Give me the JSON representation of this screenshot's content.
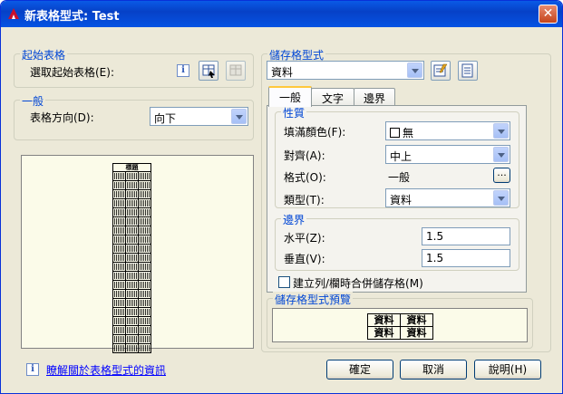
{
  "window": {
    "title": "新表格型式: Test"
  },
  "start_table": {
    "group_label": "起始表格",
    "select_label": "選取起始表格(E):"
  },
  "general": {
    "group_label": "一般",
    "direction_label": "表格方向(D):",
    "direction_value": "向下"
  },
  "left_preview": {
    "header": "標題"
  },
  "cell_style": {
    "group_label": "儲存格型式",
    "selected": "資料"
  },
  "tabs": [
    {
      "label": "一般"
    },
    {
      "label": "文字"
    },
    {
      "label": "邊界"
    }
  ],
  "properties": {
    "group_label": "性質",
    "fill_label": "填滿顏色(F):",
    "fill_value": "無",
    "align_label": "對齊(A):",
    "align_value": "中上",
    "format_label": "格式(O):",
    "format_value": "一般",
    "format_button": "...",
    "type_label": "類型(T):",
    "type_value": "資料"
  },
  "margins": {
    "group_label": "邊界",
    "horizontal_label": "水平(Z):",
    "horizontal_value": "1.5",
    "vertical_label": "垂直(V):",
    "vertical_value": "1.5"
  },
  "merge_checkbox_label": "建立列/欄時合併儲存格(M)",
  "cell_preview": {
    "group_label": "儲存格型式預覽",
    "cells": [
      "資料",
      "資料",
      "資料",
      "資料"
    ]
  },
  "footer": {
    "info_link": "瞭解關於表格型式的資訊",
    "ok": "確定",
    "cancel": "取消",
    "help": "說明(H)"
  },
  "icons": {
    "info": "i",
    "close": "✕"
  }
}
